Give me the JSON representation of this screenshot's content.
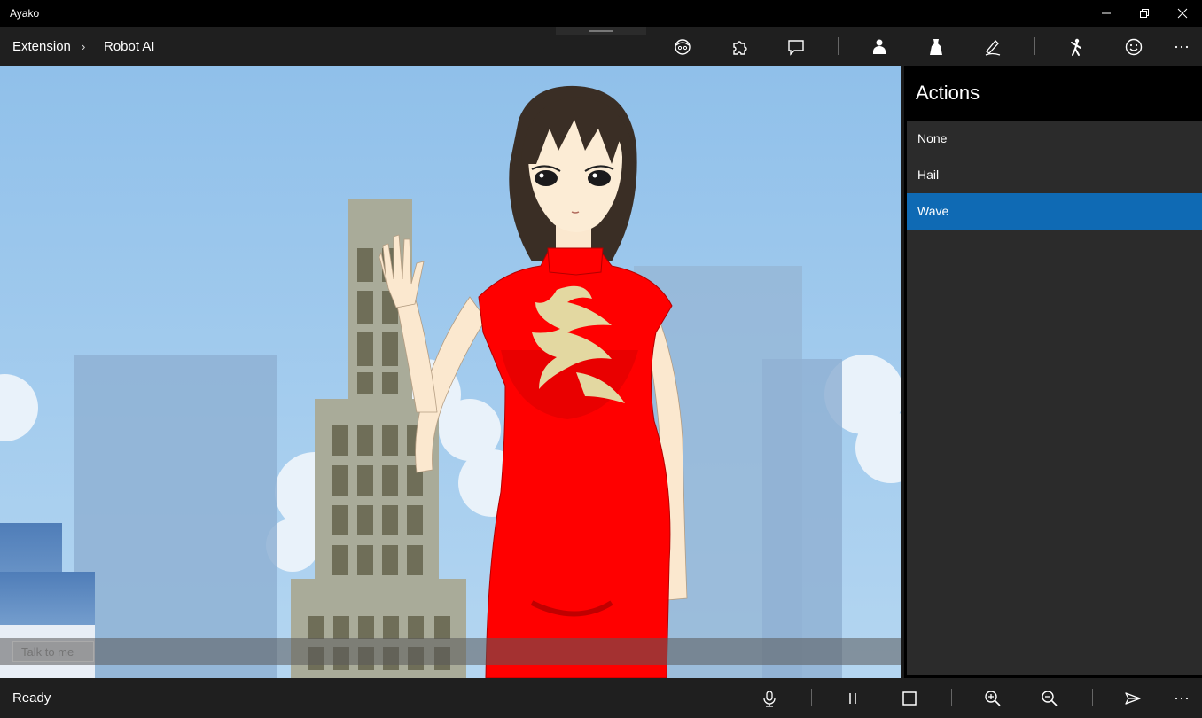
{
  "window": {
    "title": "Ayako"
  },
  "breadcrumb": {
    "items": [
      "Extension",
      "Robot AI"
    ],
    "separator": "›"
  },
  "toolbar": {
    "icons": [
      "bot-face-icon",
      "puzzle-icon",
      "chat-icon",
      "person-icon",
      "dress-icon",
      "signature-icon",
      "pose-icon",
      "smiley-icon",
      "more-icon"
    ]
  },
  "scene": {
    "sky_color": "#8fc0e8",
    "dress_color": "#ff0000"
  },
  "talk": {
    "placeholder": "Talk to me"
  },
  "actions_panel": {
    "title": "Actions",
    "items": [
      {
        "label": "None",
        "selected": false
      },
      {
        "label": "Hail",
        "selected": false
      },
      {
        "label": "Wave",
        "selected": true
      }
    ],
    "accent": "#0f6ab4"
  },
  "status": {
    "text": "Ready"
  },
  "statusbar": {
    "icons": [
      "microphone-icon",
      "pause-icon",
      "stop-icon",
      "zoom-in-icon",
      "zoom-out-icon",
      "send-icon",
      "more-icon"
    ]
  }
}
